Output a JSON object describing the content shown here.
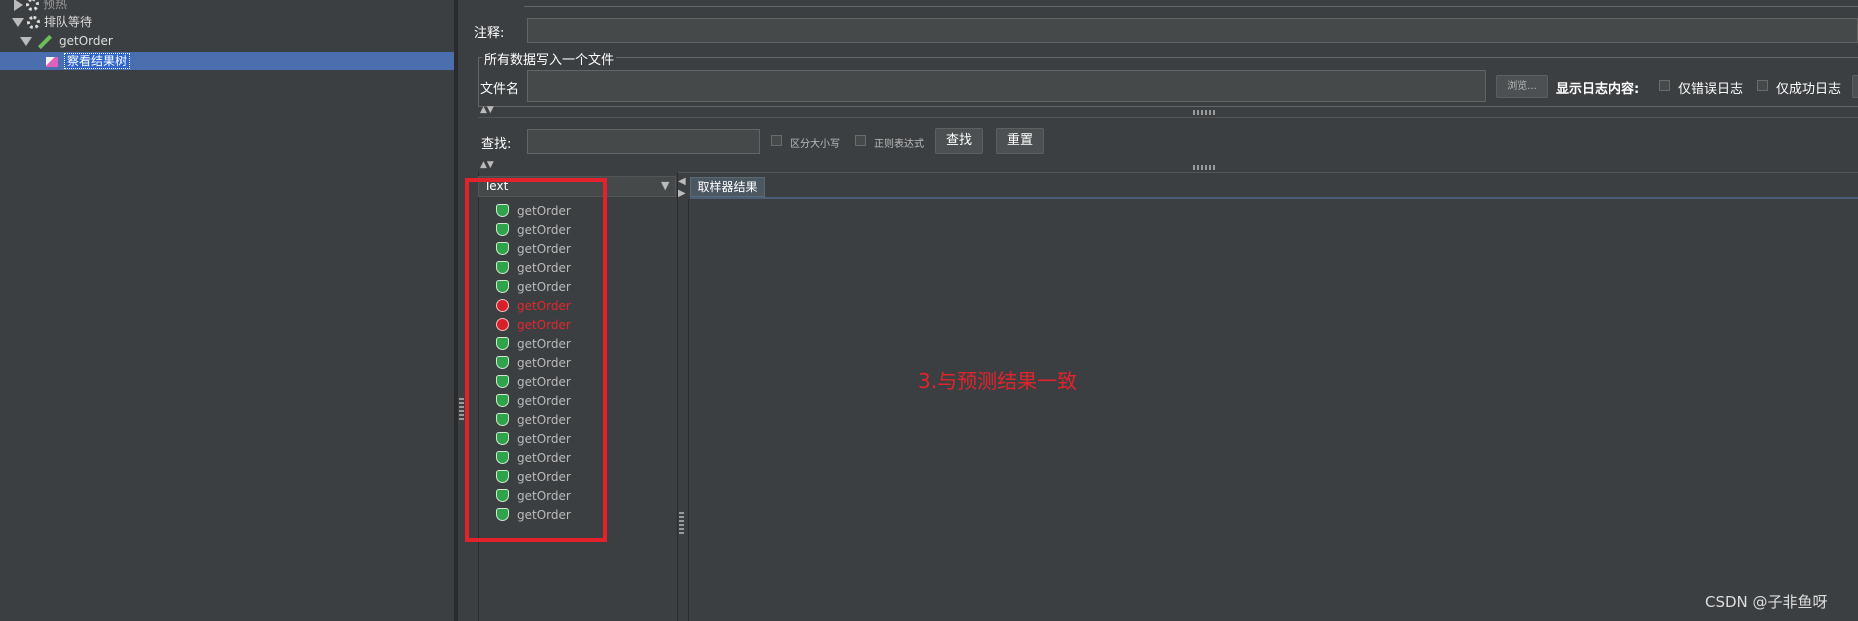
{
  "tree": {
    "items": [
      {
        "label": "预热"
      },
      {
        "label": "排队等待"
      },
      {
        "label": "getOrder"
      },
      {
        "label": "察看结果树"
      }
    ]
  },
  "form": {
    "comment_label": "注释:",
    "file_group_title": "所有数据写入一个文件",
    "filename_label": "文件名",
    "browse_button": "浏览...",
    "log_content_label": "显示日志内容:",
    "errors_only_label": "仅错误日志",
    "success_only_label": "仅成功日志"
  },
  "search": {
    "label": "查找:",
    "case_label": "区分大小写",
    "regex_label": "正则表达式",
    "find_button": "查找",
    "reset_button": "重置"
  },
  "results": {
    "column_header": "Text",
    "rows": [
      {
        "label": "getOrder",
        "status": "success"
      },
      {
        "label": "getOrder",
        "status": "success"
      },
      {
        "label": "getOrder",
        "status": "success"
      },
      {
        "label": "getOrder",
        "status": "success"
      },
      {
        "label": "getOrder",
        "status": "success"
      },
      {
        "label": "getOrder",
        "status": "error"
      },
      {
        "label": "getOrder",
        "status": "error"
      },
      {
        "label": "getOrder",
        "status": "success"
      },
      {
        "label": "getOrder",
        "status": "success"
      },
      {
        "label": "getOrder",
        "status": "success"
      },
      {
        "label": "getOrder",
        "status": "success"
      },
      {
        "label": "getOrder",
        "status": "success"
      },
      {
        "label": "getOrder",
        "status": "success"
      },
      {
        "label": "getOrder",
        "status": "success"
      },
      {
        "label": "getOrder",
        "status": "success"
      },
      {
        "label": "getOrder",
        "status": "success"
      },
      {
        "label": "getOrder",
        "status": "success"
      }
    ],
    "tab_label": "取样器结果"
  },
  "annotation": "3.与预测结果一致",
  "watermark": "CSDN @子非鱼呀",
  "colors": {
    "background": "#3c3f41",
    "selection": "#4b6eaf",
    "error_text": "#e0282e",
    "annotation_red": "#e3232b"
  }
}
